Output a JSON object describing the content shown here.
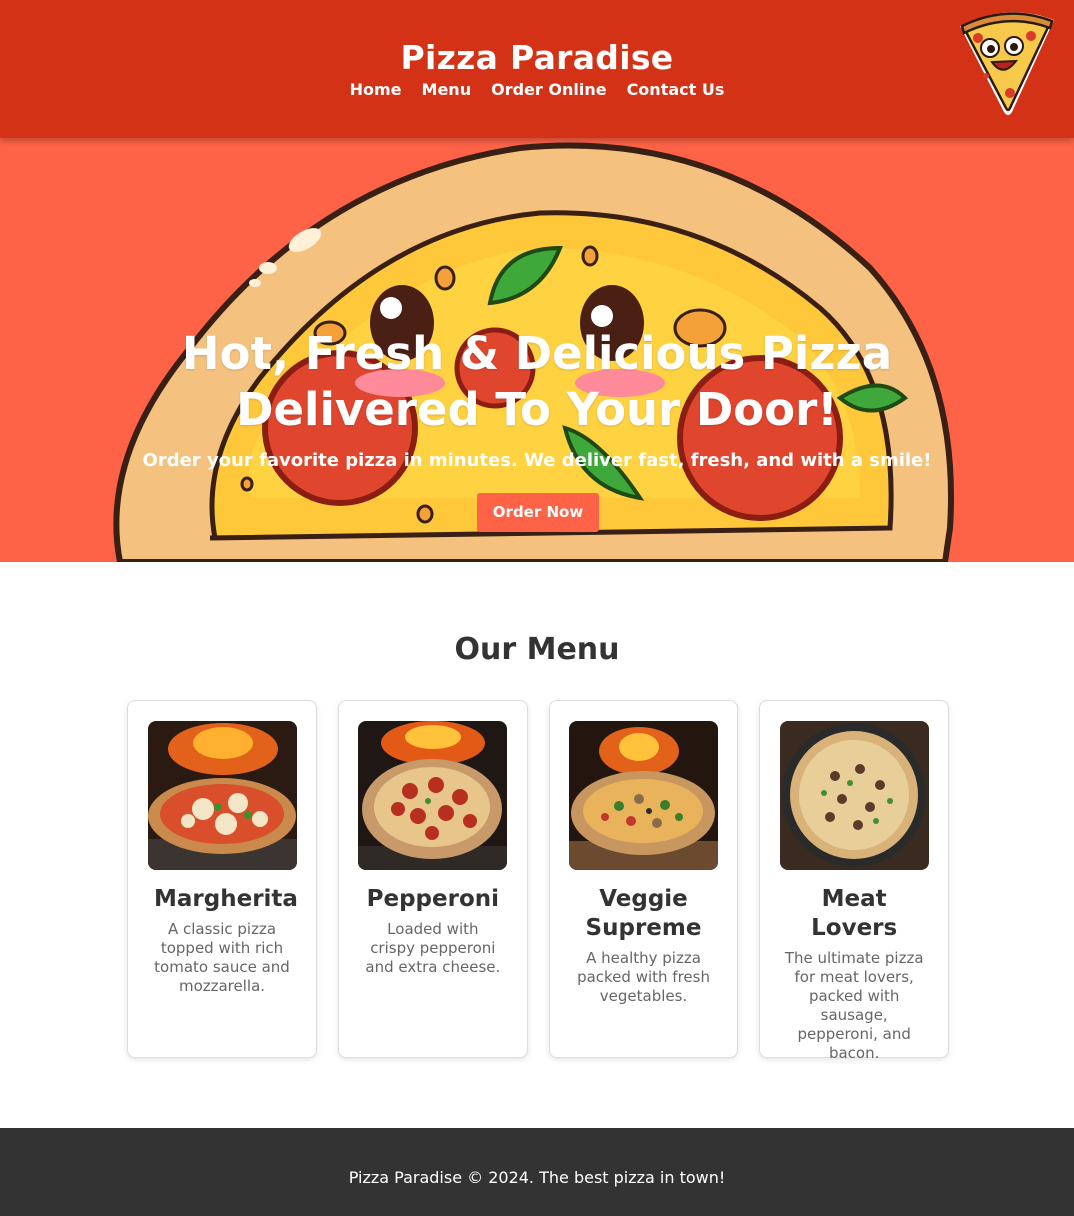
{
  "header": {
    "title": "Pizza Paradise",
    "nav": [
      "Home",
      "Menu",
      "Order Online",
      "Contact Us"
    ],
    "logo_icon": "cartoon-pizza-slice-logo"
  },
  "hero": {
    "title_line1": "Hot, Fresh & Delicious Pizza",
    "title_line2": "Delivered To Your Door!",
    "subtitle": "Order your favorite pizza in minutes. We deliver fast, fresh, and with a smile!",
    "button_label": "Order Now"
  },
  "menu": {
    "title": "Our Menu",
    "items": [
      {
        "name": "Margherita",
        "description": "A classic pizza topped with rich tomato sauce and mozzarella."
      },
      {
        "name": "Pepperoni",
        "description": "Loaded with crispy pepperoni and extra cheese."
      },
      {
        "name": "Veggie Supreme",
        "description": "A healthy pizza packed with fresh vegetables."
      },
      {
        "name": "Meat Lovers",
        "description": "The ultimate pizza for meat lovers, packed with sausage, pepperoni, and bacon."
      }
    ]
  },
  "footer": {
    "text": "Pizza Paradise © 2024. The best pizza in town!"
  },
  "colors": {
    "header_bg": "#d33217",
    "hero_bg": "#ff6347",
    "accent": "#ff6347",
    "footer_bg": "#333333",
    "heading_text": "#333333",
    "body_text": "#666666"
  }
}
